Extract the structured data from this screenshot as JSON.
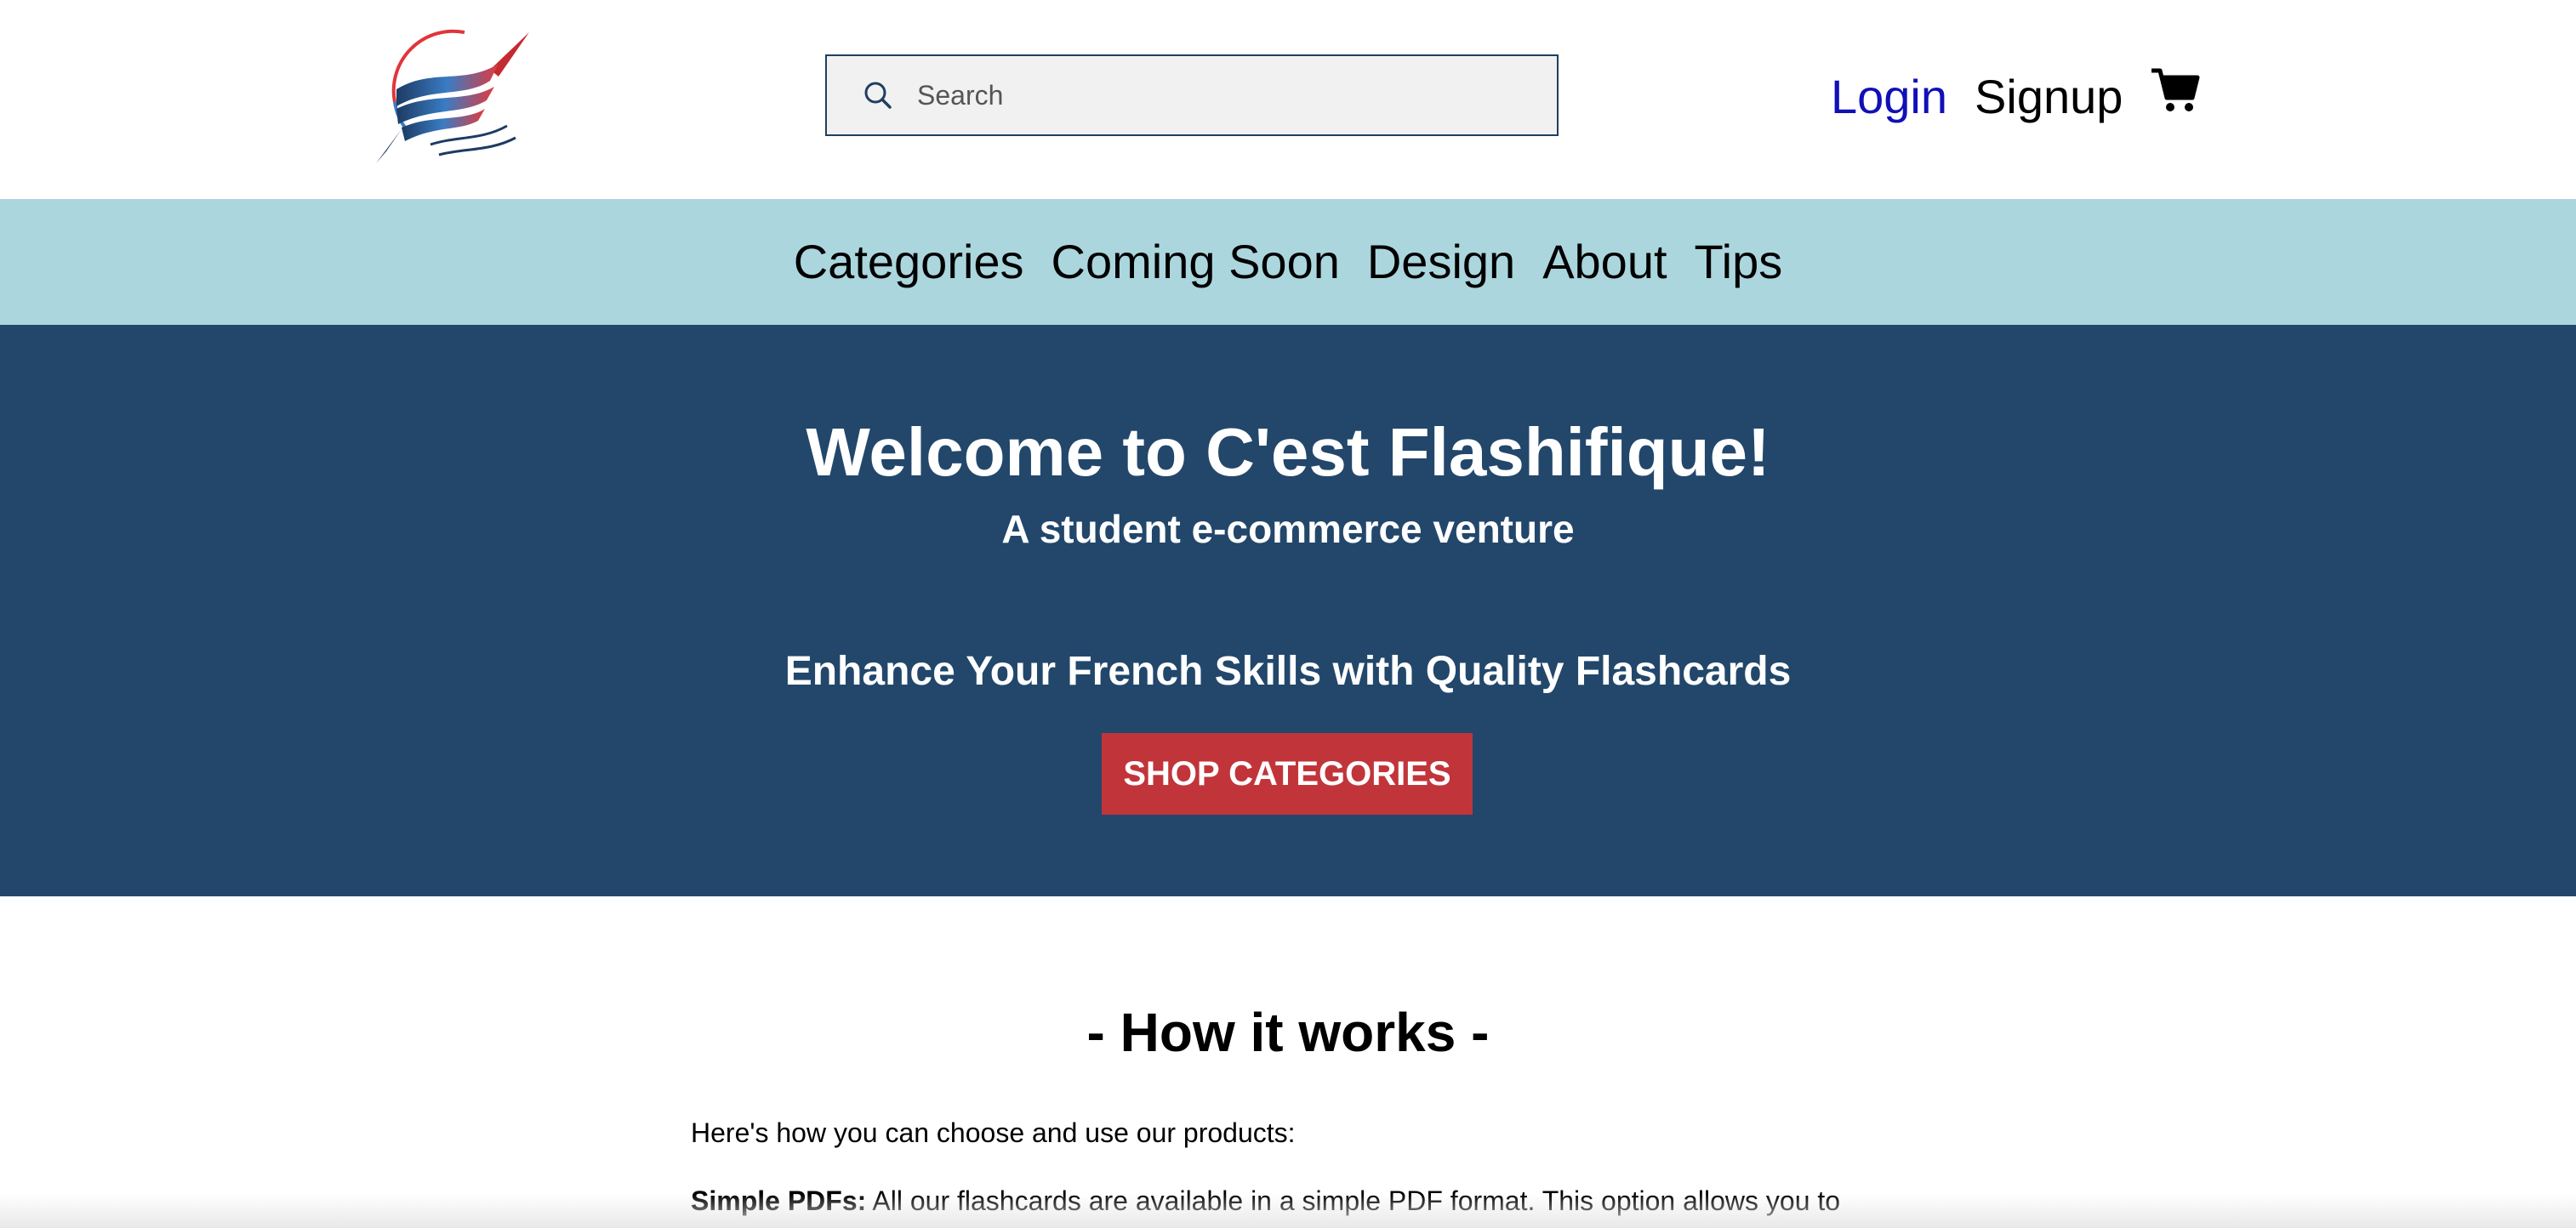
{
  "header": {
    "logo_icon": "pen-wave-logo-icon",
    "search": {
      "placeholder": "Search",
      "value": "",
      "icon": "search-icon"
    },
    "login_label": "Login",
    "signup_label": "Signup",
    "cart_icon": "cart-icon",
    "colors": {
      "login_link": "#1010b8",
      "search_border": "#1f3f5f"
    }
  },
  "nav": {
    "items": [
      {
        "label": "Categories"
      },
      {
        "label": "Coming Soon"
      },
      {
        "label": "Design"
      },
      {
        "label": "About"
      },
      {
        "label": "Tips"
      }
    ],
    "background": "#abd6de"
  },
  "hero": {
    "title": "Welcome to C'est Flashifique!",
    "subtitle": "A student e-commerce venture",
    "tagline": "Enhance Your French Skills with Quality Flashcards",
    "button_label": "SHOP CATEGORIES",
    "background": "#22476b",
    "button_color": "#c1353a"
  },
  "how_it_works": {
    "title": "- How it works -",
    "intro": "Here's how you can choose and use our products:",
    "pdf_label": "Simple PDFs:",
    "pdf_text": " All our flashcards are available in a simple PDF format. This option allows you to"
  }
}
